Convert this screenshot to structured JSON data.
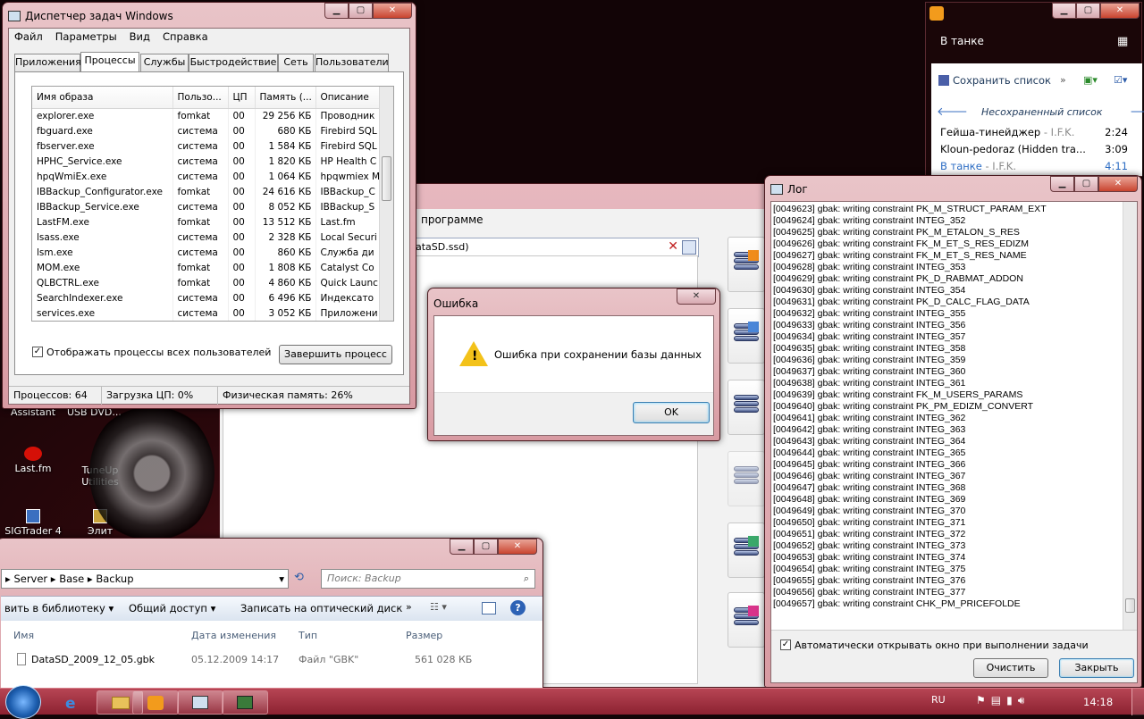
{
  "taskmgr": {
    "title": "Диспетчер задач Windows",
    "menu": [
      "Файл",
      "Параметры",
      "Вид",
      "Справка"
    ],
    "tabs": [
      "Приложения",
      "Процессы",
      "Службы",
      "Быстродействие",
      "Сеть",
      "Пользователи"
    ],
    "columns": [
      "Имя образа",
      "Пользо...",
      "ЦП",
      "Память (...",
      "Описание"
    ],
    "rows": [
      [
        "explorer.exe",
        "fomkat",
        "00",
        "29 256 КБ",
        "Проводник"
      ],
      [
        "fbguard.exe",
        "система",
        "00",
        "680 КБ",
        "Firebird SQL"
      ],
      [
        "fbserver.exe",
        "система",
        "00",
        "1 584 КБ",
        "Firebird SQL"
      ],
      [
        "HPHC_Service.exe",
        "система",
        "00",
        "1 820 КБ",
        "HP Health C"
      ],
      [
        "hpqWmiEx.exe",
        "система",
        "00",
        "1 064 КБ",
        "hpqwmiex M"
      ],
      [
        "IBBackup_Configurator.exe",
        "fomkat",
        "00",
        "24 616 КБ",
        "IBBackup_C"
      ],
      [
        "IBBackup_Service.exe",
        "система",
        "00",
        "8 052 КБ",
        "IBBackup_S"
      ],
      [
        "LastFM.exe",
        "fomkat",
        "00",
        "13 512 КБ",
        "Last.fm"
      ],
      [
        "lsass.exe",
        "система",
        "00",
        "2 328 КБ",
        "Local Securi"
      ],
      [
        "lsm.exe",
        "система",
        "00",
        "860 КБ",
        "Служба ди"
      ],
      [
        "MOM.exe",
        "fomkat",
        "00",
        "1 808 КБ",
        "Catalyst Co"
      ],
      [
        "QLBCTRL.exe",
        "fomkat",
        "00",
        "4 860 КБ",
        "Quick Launc"
      ],
      [
        "SearchIndexer.exe",
        "система",
        "00",
        "6 496 КБ",
        "Индексато"
      ],
      [
        "services.exe",
        "система",
        "00",
        "3 052 КБ",
        "Приложени"
      ]
    ],
    "show_all": "Отображать процессы всех пользователей",
    "end_process": "Завершить процесс",
    "status": [
      "Процессов: 64",
      "Загрузка ЦП: 0%",
      "Физическая память: 26%"
    ]
  },
  "player": {
    "now_playing": "В танке",
    "save_list": "Сохранить список",
    "unsaved": "Несохраненный список",
    "tracks": [
      {
        "title": "Гейша-тинейджер",
        "artist": " - I.F.K.",
        "time": "2:24"
      },
      {
        "title": "Kloun-pedoraz (Hidden tra...",
        "artist": "",
        "time": "3:09"
      },
      {
        "title": "В танке",
        "artist": " - I.F.K.",
        "time": "4:11"
      }
    ]
  },
  "app": {
    "about": "программе",
    "path": "ataSD.ssd)"
  },
  "error": {
    "title": "Ошибка",
    "message": "Ошибка при сохранении базы данных",
    "ok": "OK"
  },
  "log": {
    "title": "Лог",
    "lines": [
      "[0049623] gbak: writing constraint PK_M_STRUCT_PARAM_EXT",
      "[0049624] gbak: writing constraint INTEG_352",
      "[0049625] gbak: writing constraint PK_M_ETALON_S_RES",
      "[0049626] gbak: writing constraint FK_M_ET_S_RES_EDIZM",
      "[0049627] gbak: writing constraint FK_M_ET_S_RES_NAME",
      "[0049628] gbak: writing constraint INTEG_353",
      "[0049629] gbak: writing constraint PK_D_RABMAT_ADDON",
      "[0049630] gbak: writing constraint INTEG_354",
      "[0049631] gbak: writing constraint PK_D_CALC_FLAG_DATA",
      "[0049632] gbak: writing constraint INTEG_355",
      "[0049633] gbak: writing constraint INTEG_356",
      "[0049634] gbak: writing constraint INTEG_357",
      "[0049635] gbak: writing constraint INTEG_358",
      "[0049636] gbak: writing constraint INTEG_359",
      "[0049637] gbak: writing constraint INTEG_360",
      "[0049638] gbak: writing constraint INTEG_361",
      "[0049639] gbak: writing constraint FK_M_USERS_PARAMS",
      "[0049640] gbak: writing constraint PK_PM_EDIZM_CONVERT",
      "[0049641] gbak: writing constraint INTEG_362",
      "[0049642] gbak: writing constraint INTEG_363",
      "[0049643] gbak: writing constraint INTEG_364",
      "[0049644] gbak: writing constraint INTEG_365",
      "[0049645] gbak: writing constraint INTEG_366",
      "[0049646] gbak: writing constraint INTEG_367",
      "[0049647] gbak: writing constraint INTEG_368",
      "[0049648] gbak: writing constraint INTEG_369",
      "[0049649] gbak: writing constraint INTEG_370",
      "[0049650] gbak: writing constraint INTEG_371",
      "[0049651] gbak: writing constraint INTEG_372",
      "[0049652] gbak: writing constraint INTEG_373",
      "[0049653] gbak: writing constraint INTEG_374",
      "[0049654] gbak: writing constraint INTEG_375",
      "[0049655] gbak: writing constraint INTEG_376",
      "[0049656] gbak: writing constraint INTEG_377",
      "[0049657] gbak: writing constraint CHK_PM_PRICEFOLDE"
    ],
    "auto_open": "Автоматически открывать окно при  выполнении задачи",
    "clear": "Очистить",
    "close": "Закрыть"
  },
  "explorer": {
    "crumbs": [
      "Server",
      "Base",
      "Backup"
    ],
    "search_placeholder": "Поиск: Backup",
    "toolbar": [
      "вить в библиотеку",
      "Общий доступ",
      "Записать на оптический диск"
    ],
    "columns": [
      "Имя",
      "Дата изменения",
      "Тип",
      "Размер"
    ],
    "file": {
      "name": "DataSD_2009_12_05.gbk",
      "date": "05.12.2009 14:17",
      "type": "Файл \"GBK\"",
      "size": "561 028 КБ"
    }
  },
  "desktop": {
    "icons": [
      {
        "label": "Assistant"
      },
      {
        "label": "USB DVD..."
      },
      {
        "label": "Last.fm"
      },
      {
        "label": "TuneUp Utilities"
      },
      {
        "label": "SIGTrader 4"
      },
      {
        "label": "Элит"
      }
    ]
  },
  "taskbar": {
    "lang": "RU",
    "clock": "14:18"
  }
}
